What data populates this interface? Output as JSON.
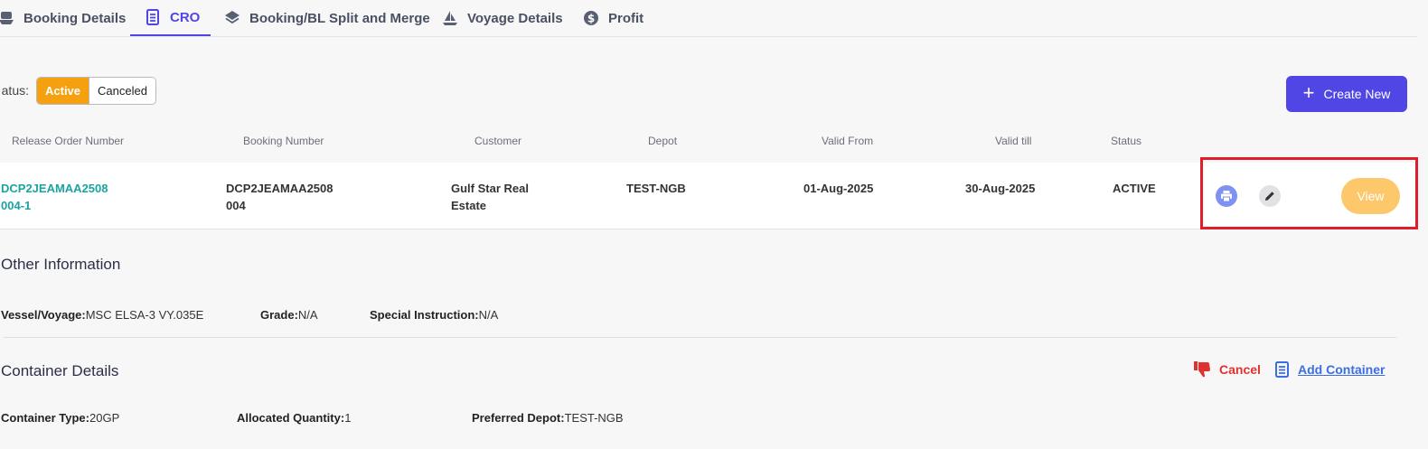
{
  "tabs": [
    {
      "label": "Booking Details",
      "icon": "ship-icon",
      "active": false
    },
    {
      "label": "CRO",
      "icon": "document-list-icon",
      "active": true
    },
    {
      "label": "Booking/BL Split and Merge",
      "icon": "layers-icon",
      "active": false
    },
    {
      "label": "Voyage Details",
      "icon": "sailboat-icon",
      "active": false
    },
    {
      "label": "Profit",
      "icon": "dollar-icon",
      "active": false
    }
  ],
  "filter": {
    "label": "atus:",
    "options": [
      "Active",
      "Canceled"
    ],
    "selected": "Active"
  },
  "create_button": "Create New",
  "table": {
    "headers": [
      "Release Order Number",
      "Booking Number",
      "Customer",
      "Depot",
      "Valid From",
      "Valid till",
      "Status"
    ],
    "row": {
      "release_order_line1": "DCP2JEAMAA2508",
      "release_order_line2": "004-1",
      "booking_line1": "DCP2JEAMAA2508",
      "booking_line2": "004",
      "customer_line1": "Gulf Star Real",
      "customer_line2": "Estate",
      "depot": "TEST-NGB",
      "valid_from": "01-Aug-2025",
      "valid_till": "30-Aug-2025",
      "status": "ACTIVE",
      "view_label": "View"
    }
  },
  "other_info": {
    "title": "Other Information",
    "vessel_label": "Vessel/Voyage:",
    "vessel_value": "MSC ELSA-3 VY.035E",
    "grade_label": "Grade:",
    "grade_value": "N/A",
    "instruction_label": "Special Instruction:",
    "instruction_value": "N/A"
  },
  "container_details": {
    "title": "Container Details",
    "cancel_label": "Cancel",
    "add_label": "Add Container",
    "type_label": "Container Type:",
    "type_value": "20GP",
    "qty_label": "Allocated Quantity:",
    "qty_value": "1",
    "depot_label": "Preferred Depot:",
    "depot_value": "TEST-NGB"
  },
  "colors": {
    "accent": "#4f46e5",
    "active_orange": "#f5a00f",
    "link_teal": "#1aa3a3",
    "cancel_red": "#e03131",
    "highlight_red": "#e01e2b"
  }
}
